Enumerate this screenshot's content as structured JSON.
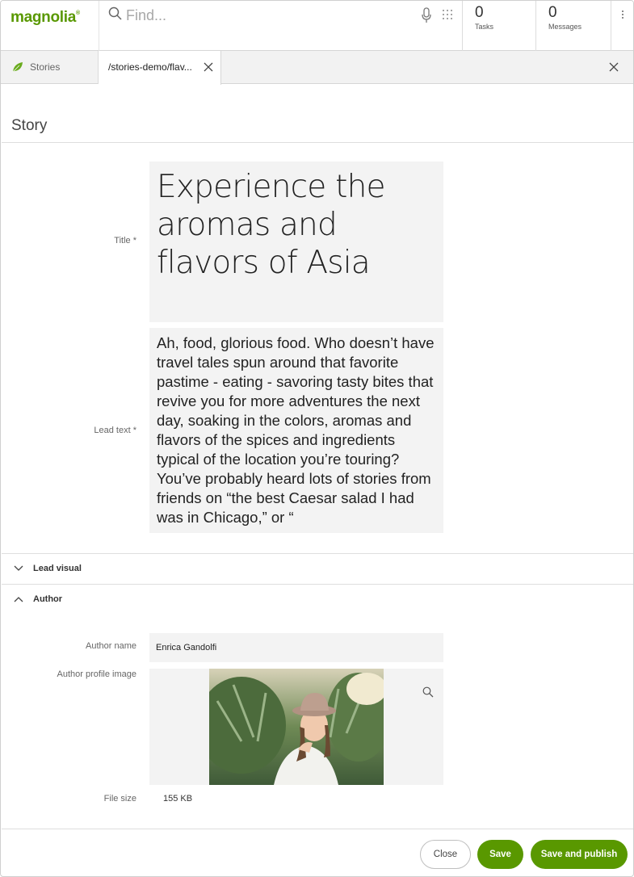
{
  "header": {
    "logo": "magnolia",
    "logo_mark": "®",
    "search_placeholder": "Find...",
    "tasks": {
      "count": "0",
      "label": "Tasks"
    },
    "messages": {
      "count": "0",
      "label": "Messages"
    }
  },
  "tabs": {
    "stories": "Stories",
    "active": "/stories-demo/flav..."
  },
  "page": {
    "title": "Story"
  },
  "form": {
    "title_label": "Title *",
    "title_value": "Experience the aromas and flavors of Asia",
    "lead_label": "Lead text *",
    "lead_value": "Ah, food, glorious food. Who doesn’t have travel tales spun around that favorite pastime - eating - savoring tasty bites that revive you for more adventures the next day, soaking in the colors, aromas and flavors of the spices and ingredients typical of the location you’re touring? You’ve probably heard lots of stories from friends on “the best Caesar salad I had was in Chicago,” or “",
    "sections": {
      "lead_visual": "Lead visual",
      "author": "Author"
    },
    "author_name_label": "Author name",
    "author_name_value": "Enrica Gandolfi",
    "author_image_label": "Author profile image",
    "file_size_label": "File size",
    "file_size_value": "155 KB"
  },
  "actions": {
    "close": "Close",
    "save": "Save",
    "save_publish": "Save and publish"
  },
  "colors": {
    "brand": "#599800"
  }
}
